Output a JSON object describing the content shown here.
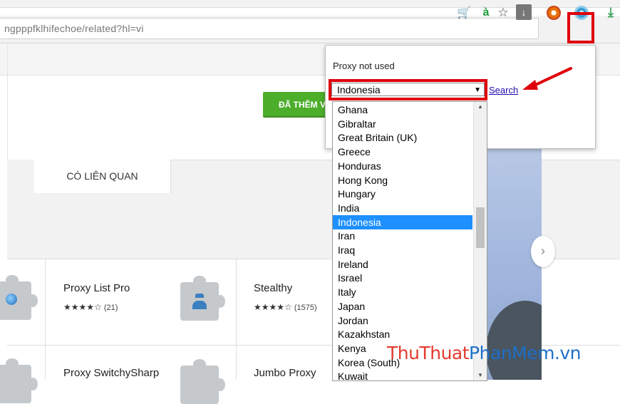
{
  "browser": {
    "url": "ngpppfklhifechoe/related?hl=vi",
    "toolbar_icons": [
      "cart-icon",
      "accent-a-icon",
      "star-icon",
      "download-box-icon",
      "chrome-store-icon",
      "proxy-extension-icon",
      "download-arrow-icon"
    ],
    "icon_glyphs": {
      "cart": "🛒",
      "accent_a": "à",
      "star": "☆",
      "download_box": "↓",
      "green_download": "⤓"
    }
  },
  "page": {
    "added_button": "ĐÃ THÊM V",
    "tab_related": "CÓ LIÊN QUAN",
    "extensions": [
      {
        "title": "Proxy List Pro",
        "stars": "★★★★☆",
        "count": "(21)"
      },
      {
        "title": "Stealthy",
        "stars": "★★★★☆",
        "count": "(1575)"
      },
      {
        "title": "Proxy SwitchySharp",
        "stars": "",
        "count": ""
      },
      {
        "title": "Jumbo Proxy",
        "stars": "",
        "count": ""
      }
    ],
    "next_glyph": "›"
  },
  "popup": {
    "status": "Proxy not used",
    "selected_country": "Indonesia",
    "select_arrow": "▼",
    "search_link": "Search",
    "options": [
      "Ghana",
      "Gibraltar",
      "Great Britain (UK)",
      "Greece",
      "Honduras",
      "Hong Kong",
      "Hungary",
      "India",
      "Indonesia",
      "Iran",
      "Iraq",
      "Ireland",
      "Israel",
      "Italy",
      "Japan",
      "Jordan",
      "Kazakhstan",
      "Kenya",
      "Korea (South)",
      "Kuwait"
    ],
    "selected_index": 8,
    "scroll_up": "▲",
    "scroll_down": "▼"
  },
  "colors": {
    "highlight": "#e0000b",
    "selected_option": "#1e90ff",
    "added_button": "#4cae2b"
  },
  "watermark": {
    "part1": "ThuThuat",
    "part2": "PhanMem.vn"
  }
}
